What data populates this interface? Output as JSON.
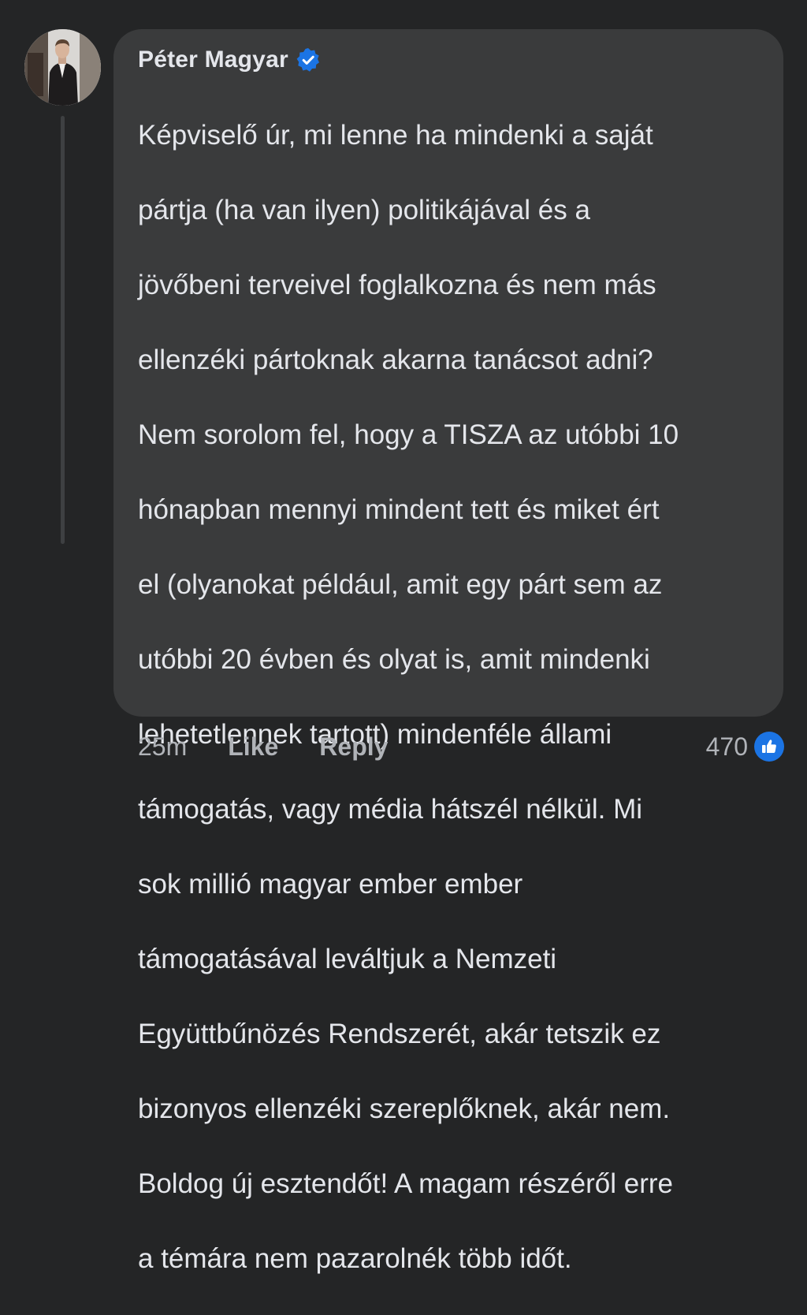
{
  "comment": {
    "author": "Péter Magyar",
    "verified_icon": "verified-badge-icon",
    "lines": [
      "Képviselő úr, mi lenne ha mindenki a saját",
      "pártja (ha van ilyen) politikájával és a",
      "jövőbeni terveivel foglalkozna és nem más",
      "ellenzéki pártoknak akarna tanácsot adni?",
      "Nem sorolom fel, hogy a TISZA az utóbbi 10",
      "hónapban mennyi mindent tett és miket ért",
      "el (olyanokat például, amit egy párt sem az",
      "utóbbi 20 évben és olyat is, amit mindenki",
      "lehetetlennek tartott) mindenféle állami",
      "támogatás, vagy média hátszél nélkül. Mi",
      "sok millió magyar ember ember",
      "támogatásával leváltjuk a Nemzeti",
      "Együttbűnözés Rendszerét, akár tetszik ez",
      "bizonyos ellenzéki szereplőknek, akár nem.",
      "Boldog új esztendőt! A magam részéről erre",
      "a témára nem pazarolnék több időt."
    ]
  },
  "actions": {
    "time": "25m",
    "like_label": "Like",
    "reply_label": "Reply"
  },
  "reactions": {
    "count": "470",
    "icon": "thumbs-up-icon"
  },
  "colors": {
    "background": "#242526",
    "bubble": "#3a3b3c",
    "text": "#e4e6eb",
    "secondary_text": "#b0b3b8",
    "accent_blue": "#1b74e4",
    "thread_line": "#3e4042"
  }
}
